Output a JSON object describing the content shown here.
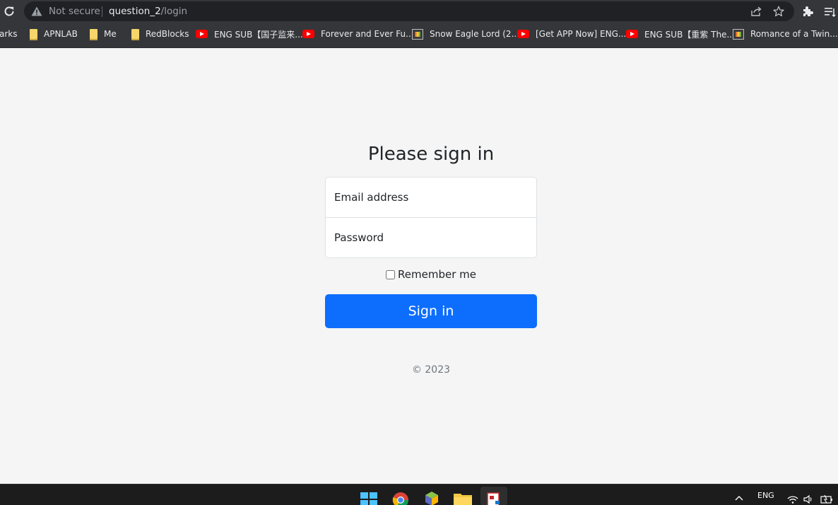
{
  "browser": {
    "security_text": "Not secure",
    "url_host": "question_2",
    "url_path": "/login",
    "bookmarks": [
      {
        "label": "arks",
        "icon": "none"
      },
      {
        "label": "APNLAB",
        "icon": "folder-icon"
      },
      {
        "label": "Me",
        "icon": "folder-icon"
      },
      {
        "label": "RedBlocks",
        "icon": "folder-icon"
      },
      {
        "label": "ENG SUB【国子监来...",
        "icon": "youtube-icon"
      },
      {
        "label": "Forever and Ever Fu...",
        "icon": "youtube-icon"
      },
      {
        "label": "Snow Eagle Lord (2...",
        "icon": "film-icon"
      },
      {
        "label": "[Get APP Now] ENG...",
        "icon": "youtube-icon"
      },
      {
        "label": "ENG SUB【重紫 The...",
        "icon": "youtube-icon"
      },
      {
        "label": "Romance of a Twin...",
        "icon": "film-icon"
      }
    ]
  },
  "login": {
    "heading": "Please sign in",
    "email_placeholder": "Email address",
    "password_placeholder": "Password",
    "remember_label": "Remember me",
    "remember_checked": false,
    "submit_label": "Sign in",
    "copyright": "© 2023"
  },
  "taskbar": {
    "language": "ENG"
  },
  "colors": {
    "primary": "#0d6efd",
    "page_background": "#f5f5f5",
    "chrome_background": "#35363a"
  }
}
